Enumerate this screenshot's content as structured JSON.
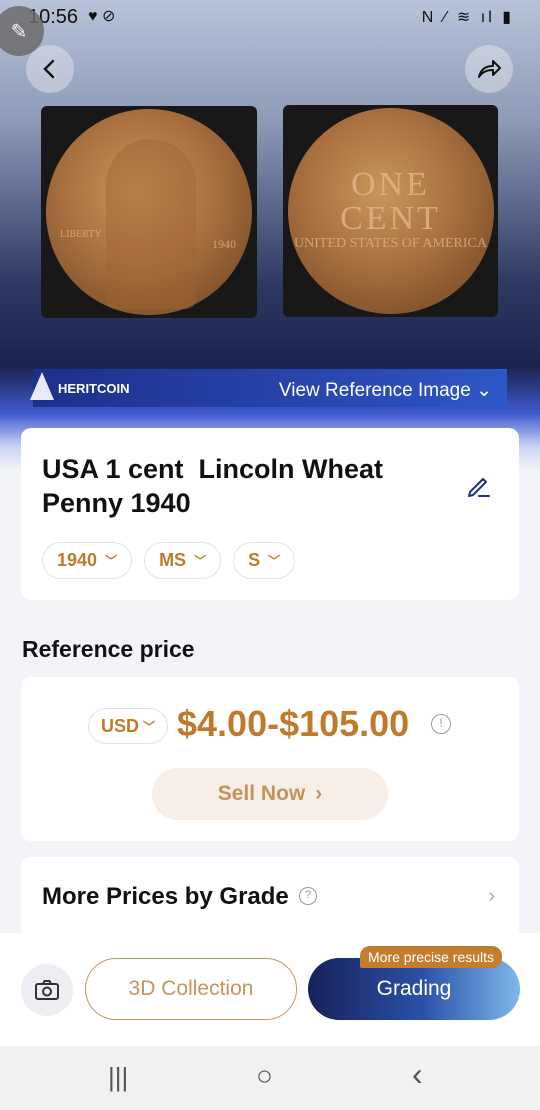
{
  "status": {
    "time": "10:56",
    "left_icons": "♥ ⊘",
    "right_icons": "N ⁄ ≋ ıl ▮"
  },
  "header": {
    "back_icon": "chevron-left",
    "share_icon": "share-arrow"
  },
  "coin_images": {
    "front": {
      "liberty": "LIBERTY",
      "year": "1940"
    },
    "back": {
      "line1": "ONE",
      "line2": "CENT",
      "line3": "UNITED STATES OF AMERICA"
    }
  },
  "reference_bar": {
    "brand": "HERITCOIN",
    "link": "View Reference Image",
    "chevron": "⌄"
  },
  "coin": {
    "title": "USA 1 cent  Lincoln Wheat Penny 1940",
    "chips": [
      {
        "label": "1940",
        "arrow": "⌄"
      },
      {
        "label": "MS",
        "arrow": "⌄"
      },
      {
        "label": "S",
        "arrow": "⌄"
      }
    ]
  },
  "reference_price": {
    "heading": "Reference price",
    "currency": "USD",
    "currency_arrow": "⌄",
    "price": "$4.00-$105.00",
    "info": "!",
    "sell_label": "Sell Now",
    "sell_arrow": "›"
  },
  "grades": {
    "title": "More Prices by Grade",
    "help": "?",
    "arrow": "›"
  },
  "bottom": {
    "collection_label": "3D Collection",
    "grading_label": "Grading",
    "badge": "More precise results"
  },
  "nav": {
    "recents": "|||",
    "home": "○",
    "back": "‹"
  },
  "colors": {
    "accent": "#c07a2c",
    "brand_blue": "#1c2f8a"
  }
}
